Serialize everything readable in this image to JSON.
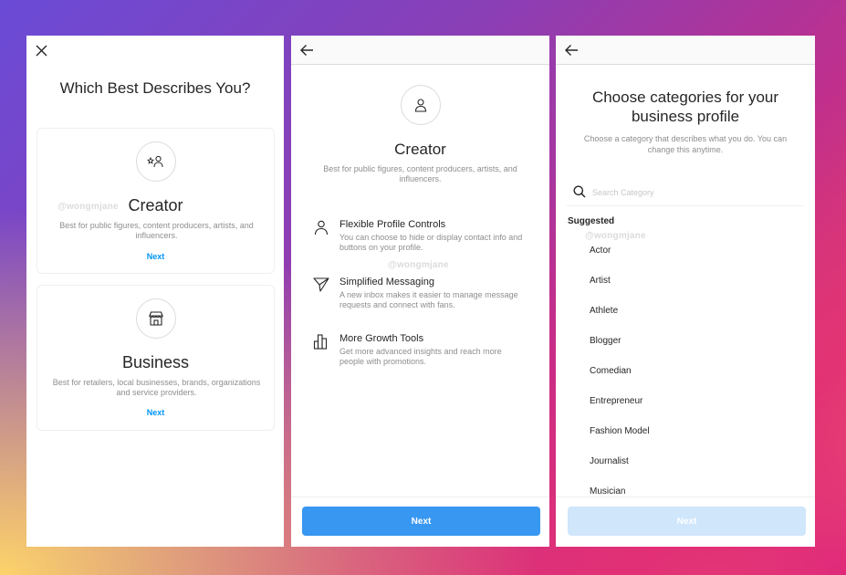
{
  "screen1": {
    "title": "Which Best Describes You?",
    "watermark": "@wongmjane",
    "cards": [
      {
        "icon": "creator-star-person-icon",
        "title": "Creator",
        "description": "Best for public figures, content producers, artists, and influencers.",
        "next_label": "Next"
      },
      {
        "icon": "storefront-icon",
        "title": "Business",
        "description": "Best for retailers, local businesses, brands, organizations and service providers.",
        "next_label": "Next"
      }
    ]
  },
  "screen2": {
    "title": "Creator",
    "description": "Best for public figures, content producers, artists, and influencers.",
    "watermark": "@wongmjane",
    "features": [
      {
        "icon": "person-icon",
        "title": "Flexible Profile Controls",
        "description": "You can choose to hide or display contact info and buttons on your profile."
      },
      {
        "icon": "paper-plane-icon",
        "title": "Simplified Messaging",
        "description": "A new inbox makes it easier to manage message requests and connect with fans."
      },
      {
        "icon": "bar-chart-icon",
        "title": "More Growth Tools",
        "description": "Get more advanced insights and reach more people with promotions."
      }
    ],
    "next_label": "Next"
  },
  "screen3": {
    "title": "Choose categories for your business profile",
    "description": "Choose a category that describes what you do. You can change this anytime.",
    "search_placeholder": "Search Category",
    "section_label": "Suggested",
    "watermark": "@wongmjane",
    "categories": [
      "Actor",
      "Artist",
      "Athlete",
      "Blogger",
      "Comedian",
      "Entrepreneur",
      "Fashion Model",
      "Journalist",
      "Musician"
    ],
    "next_label": "Next"
  },
  "colors": {
    "accent_blue": "#3897f0",
    "link_blue": "#0095f6",
    "disabled_blue": "#cfe6fb"
  }
}
